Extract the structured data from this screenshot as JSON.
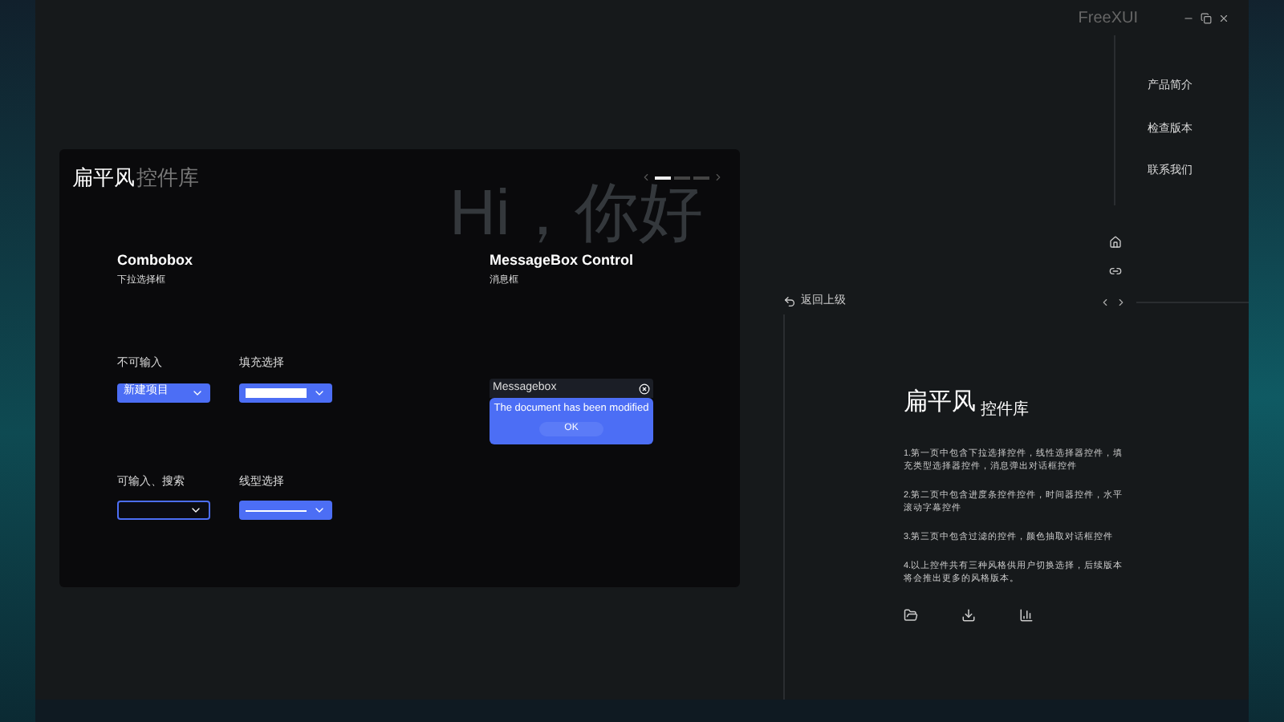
{
  "window": {
    "title": "FreeXUI"
  },
  "background_text": "Hi，你好",
  "card": {
    "title_main": "扁平风",
    "title_sub": "控件库",
    "pages": [
      {
        "selected": true
      },
      {
        "selected": false
      },
      {
        "selected": false
      }
    ],
    "combobox": {
      "title": "Combobox",
      "subtitle": "下拉选择框",
      "items": [
        {
          "kind": "text",
          "label": "不可输入",
          "value": "新建项目"
        },
        {
          "kind": "fill",
          "label": "填充选择"
        },
        {
          "kind": "outline",
          "label": "可输入、搜索"
        },
        {
          "kind": "line",
          "label": "线型选择"
        }
      ]
    },
    "messagebox": {
      "title": "MessageBox Control",
      "subtitle": "消息框",
      "box_title": "Messagebox",
      "message": "The document has been modified",
      "button": "OK"
    }
  },
  "menu": [
    {
      "label": "产品简介"
    },
    {
      "label": "检查版本"
    },
    {
      "label": "联系我们"
    }
  ],
  "back_link": "返回上级",
  "intro": {
    "title_main": "扁平风",
    "title_sub": "控件库",
    "paragraphs": [
      "1.第一页中包含下拉选择控件，线性选择器控件，填充类型选择器控件，消息弹出对话框控件",
      "2.第二页中包含进度条控件控件，时间器控件，水平滚动字幕控件",
      "3.第三页中包含过滤的控件，颜色抽取对话框控件",
      "4.以上控件共有三种风格供用户切换选择，后续版本将会推出更多的风格版本。"
    ]
  }
}
